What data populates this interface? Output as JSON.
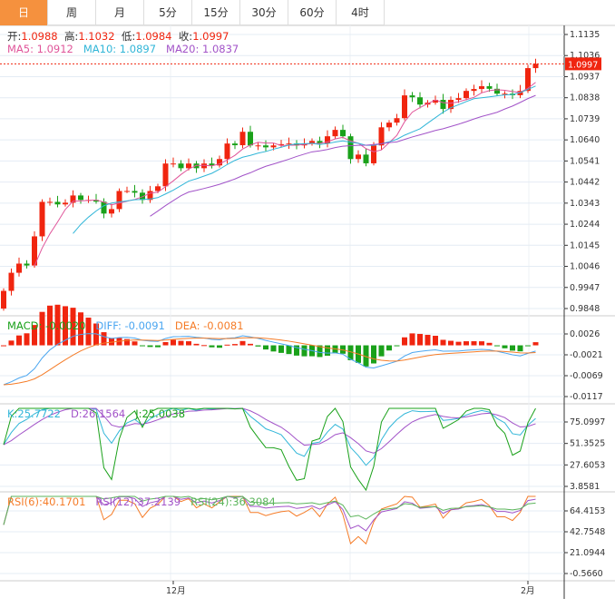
{
  "tabs": [
    "日",
    "周",
    "月",
    "5分",
    "15分",
    "30分",
    "60分",
    "4时"
  ],
  "active_tab": 0,
  "ohlc": {
    "open_label": "开:",
    "open": "1.0988",
    "high_label": "高:",
    "high": "1.1032",
    "low_label": "低:",
    "low": "1.0984",
    "close_label": "收:",
    "close": "1.0997"
  },
  "ma": {
    "ma5": "MA5: 1.0912",
    "ma10": "MA10: 1.0897",
    "ma20": "MA20: 1.0837"
  },
  "macd": {
    "macd": "MACD: -0.0020",
    "diff": "DIFF: -0.0091",
    "dea": "DEA: -0.0081"
  },
  "kdj": {
    "k": "K:25.7722",
    "d": "D:26.1564",
    "j": "J:25.0038"
  },
  "rsi": {
    "rsi6": "RSI(6):40.1701",
    "rsi12": "RSI(12):37.2139",
    "rsi24": "RSI(24):36.3084"
  },
  "current_price": "1.0997",
  "colors": {
    "up": "#f0250f",
    "down": "#1aa11a",
    "ma5": "#e0559a",
    "ma10": "#31b6d8",
    "ma20": "#a253c8",
    "accent": "#f5913e"
  },
  "chart_data": {
    "type": "candlestick",
    "first_open": 0.9848,
    "closes": [
      0.9931,
      1.0016,
      1.0059,
      1.005,
      1.0187,
      1.0349,
      1.0349,
      1.0337,
      1.0345,
      1.0379,
      1.0358,
      1.0358,
      1.035,
      1.0294,
      1.0315,
      1.04,
      1.04,
      1.0392,
      1.0358,
      1.04,
      1.0422,
      1.0529,
      1.0529,
      1.0507,
      1.0529,
      1.0507,
      1.0529,
      1.052,
      1.055,
      1.0623,
      1.0615,
      1.0678,
      1.0614,
      1.0614,
      1.0605,
      1.0614,
      1.062,
      1.0623,
      1.0614,
      1.0623,
      1.0635,
      1.0623,
      1.0657,
      1.0687,
      1.0657,
      1.055,
      1.0571,
      1.053,
      1.0614,
      1.0699,
      1.0721,
      1.0742,
      1.0849,
      1.084,
      1.0806,
      1.0815,
      1.0828,
      1.0785,
      1.0828,
      1.0836,
      1.087,
      1.0879,
      1.0892,
      1.088,
      1.0857,
      1.0857,
      1.085,
      1.087,
      1.0977,
      1.0997
    ],
    "price_ticks": [
      "1.1135",
      "1.1036",
      "1.0937",
      "1.0838",
      "1.0739",
      "1.0640",
      "1.0541",
      "1.0442",
      "1.0343",
      "1.0244",
      "1.0145",
      "1.0046",
      "0.9947",
      "0.9848"
    ],
    "macd_ticks": [
      "0.0026",
      "-0.0021",
      "-0.0069",
      "-0.0117"
    ],
    "kdj_ticks": [
      "75.0997",
      "51.3525",
      "27.6053",
      "3.8581"
    ],
    "rsi_ticks": [
      "64.4153",
      "42.7548",
      "21.0944",
      "-0.5660"
    ],
    "x_labels": [
      {
        "index": 22,
        "label": "12月"
      },
      {
        "index": 68,
        "label": "2月"
      }
    ]
  }
}
